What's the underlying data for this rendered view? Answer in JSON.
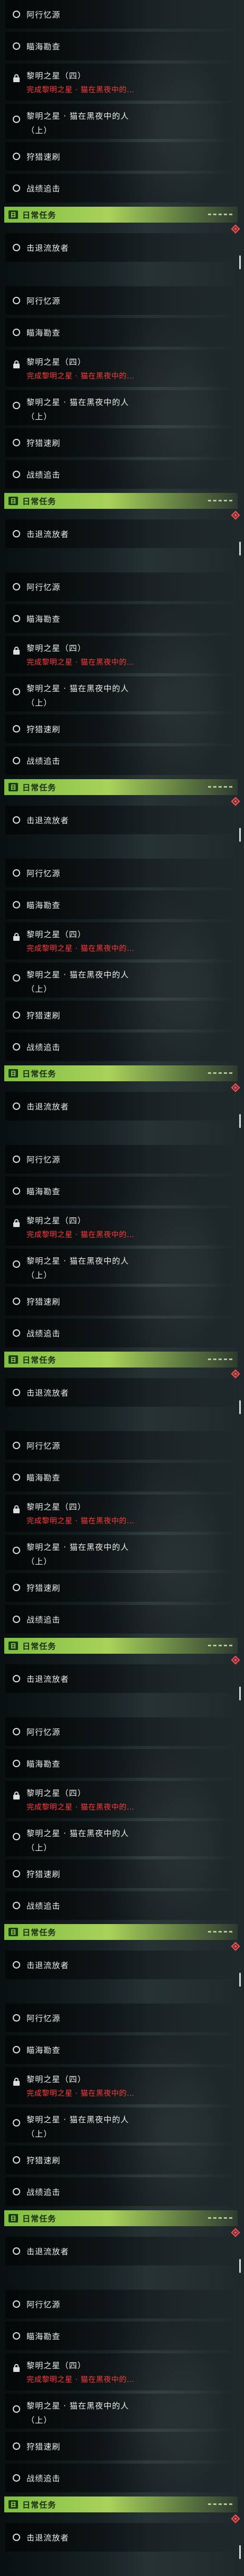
{
  "quests": {
    "q1": "阿行忆源",
    "q2": "瞄海勘查",
    "q3_title": "黎明之星（四）",
    "q3_sub": "完成黎明之星 · 猫在黑夜中的…",
    "q4_line1": "黎明之星 · 猫在黑夜中的人",
    "q4_line2": "（上）",
    "q5": "狩猎速刷",
    "q6": "战绩追击"
  },
  "daily": {
    "icon_glyph": "日",
    "label": "日常任务",
    "quest": "击退流放者"
  },
  "panel_count": 9,
  "colors": {
    "accent_green": "#a9d25a",
    "alert_red": "#ff3b3b"
  },
  "icons": [
    "circle-icon",
    "lock-icon",
    "diamond-icon",
    "daily-icon"
  ]
}
